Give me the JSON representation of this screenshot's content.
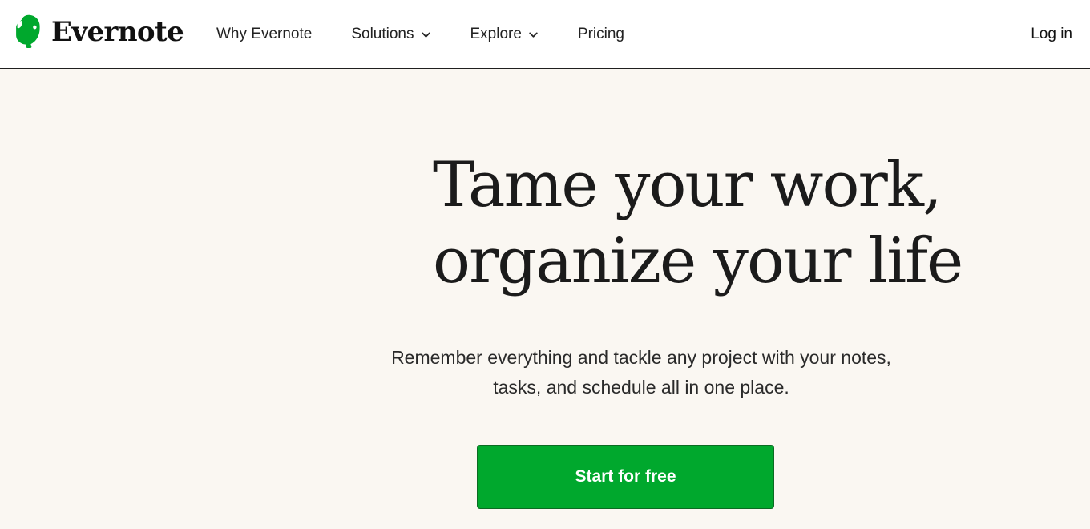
{
  "brand": {
    "name": "Evernote",
    "logo_icon": "evernote-elephant-icon",
    "accent_color": "#00a82d"
  },
  "nav": {
    "items": [
      {
        "label": "Why Evernote",
        "has_dropdown": false
      },
      {
        "label": "Solutions",
        "has_dropdown": true
      },
      {
        "label": "Explore",
        "has_dropdown": true
      },
      {
        "label": "Pricing",
        "has_dropdown": false
      }
    ],
    "login_label": "Log in",
    "dropdown_icon": "chevron-down-icon"
  },
  "hero": {
    "headline_lines": [
      "Tame your work,",
      "organize your life"
    ],
    "subtext_lines": [
      "Remember everything and tackle any project with your notes,",
      "tasks, and schedule all in one place."
    ],
    "cta_label": "Start for free",
    "background_color": "#faf7f2"
  }
}
